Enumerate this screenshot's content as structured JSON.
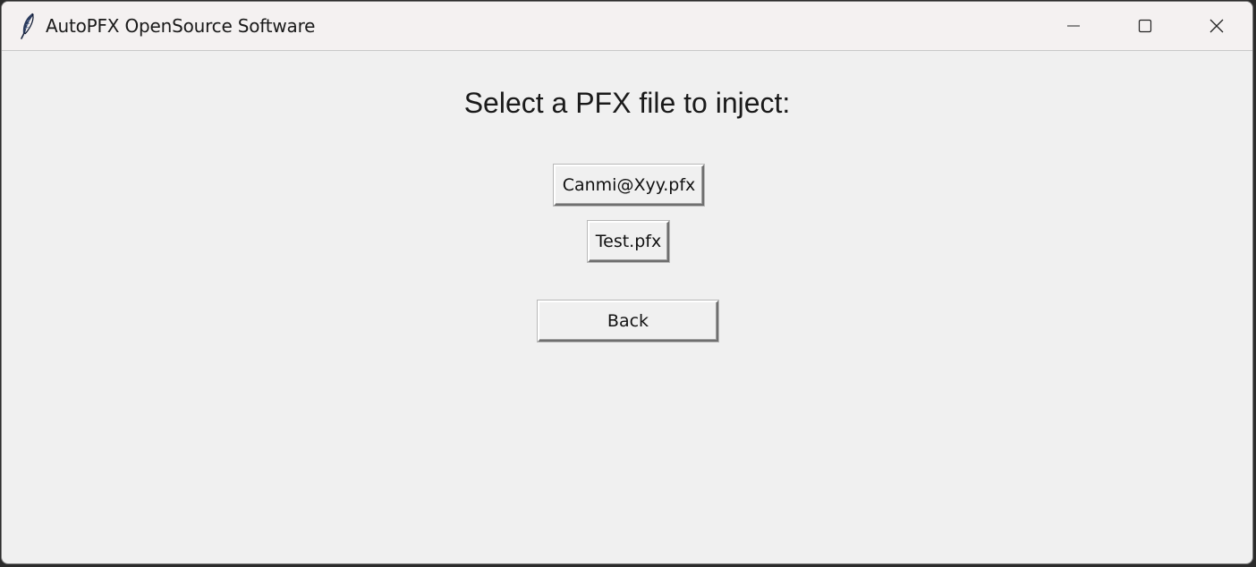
{
  "window": {
    "title": "AutoPFX OpenSource Software",
    "icons": {
      "app": "feather-icon",
      "minimize": "minimize-icon",
      "maximize": "maximize-icon",
      "close": "close-icon"
    }
  },
  "main": {
    "heading": "Select a PFX file to inject:",
    "files": [
      {
        "label": "Canmi@Xyy.pfx"
      },
      {
        "label": "Test.pfx"
      }
    ],
    "back_label": "Back"
  }
}
